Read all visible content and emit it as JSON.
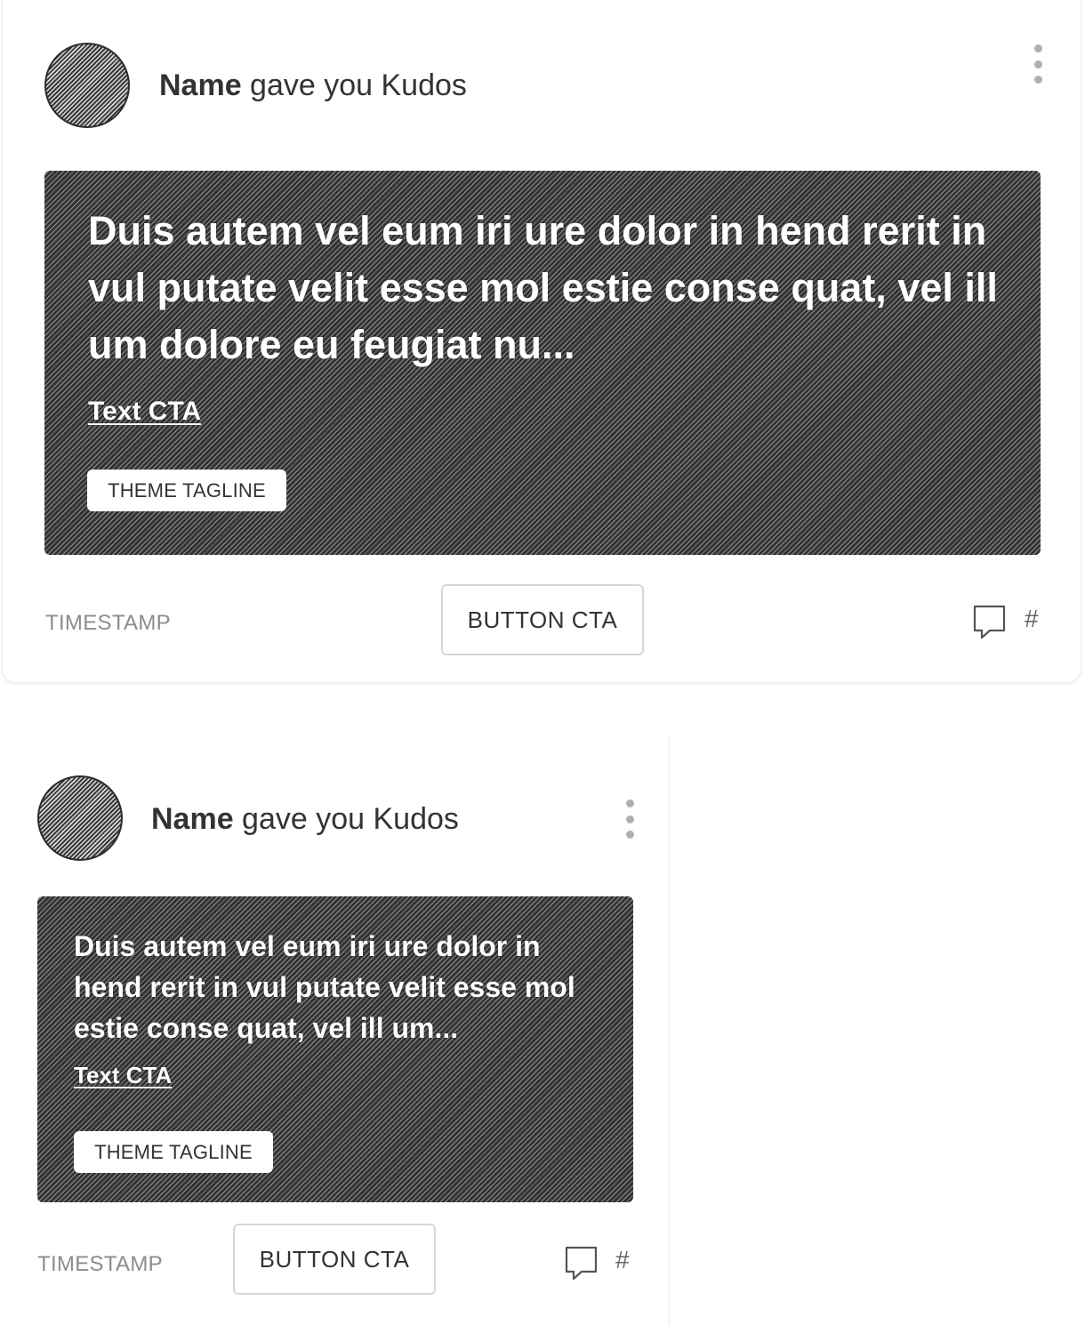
{
  "cards": [
    {
      "author_name": "Name",
      "action_text": " gave you Kudos",
      "message": "Duis autem vel eum iri ure dolor in hend rerit in vul putate velit esse mol estie conse quat, vel ill um dolore eu feugiat nu...",
      "text_cta": "Text CTA",
      "theme_tagline": "THEME TAGLINE",
      "timestamp": "TIMESTAMP",
      "button_cta": "BUTTON CTA",
      "comment_count": "#",
      "icons": {
        "avatar": "avatar-placeholder",
        "menu": "more-vertical-icon",
        "comment": "comment-icon"
      }
    },
    {
      "author_name": "Name",
      "action_text": " gave you Kudos",
      "message": "Duis autem vel eum iri ure dolor in hend rerit in vul putate velit esse mol estie conse quat, vel ill um...",
      "text_cta": "Text CTA",
      "theme_tagline": "THEME TAGLINE",
      "timestamp": "TIMESTAMP",
      "button_cta": "BUTTON CTA",
      "comment_count": "#",
      "icons": {
        "avatar": "avatar-placeholder",
        "menu": "more-vertical-icon",
        "comment": "comment-icon"
      }
    }
  ],
  "colors": {
    "text_primary": "#333333",
    "text_muted": "#8c8c8c",
    "media_background": "#3a3a3a",
    "button_border": "#d6d6d6",
    "card_border": "#ececec"
  }
}
